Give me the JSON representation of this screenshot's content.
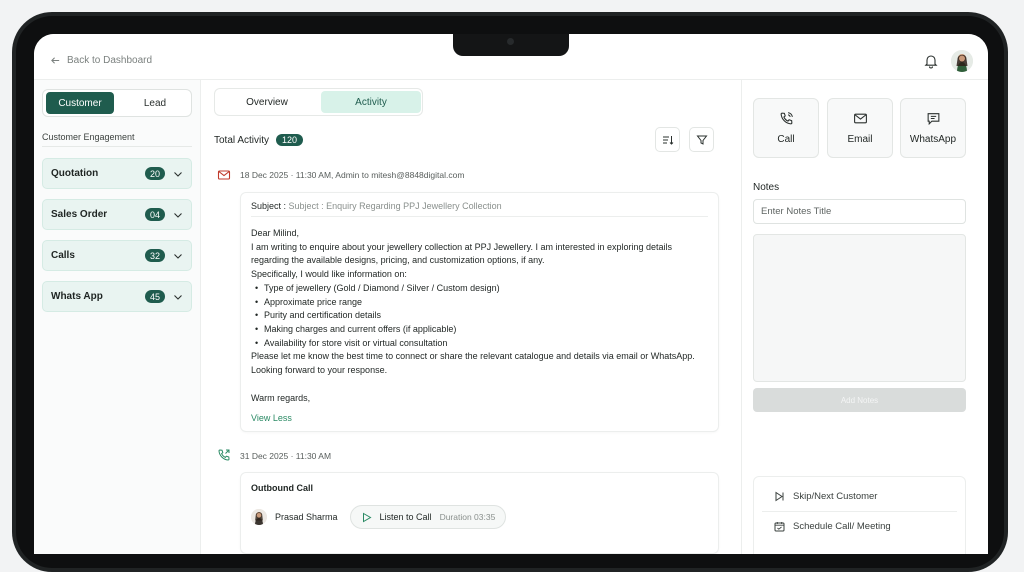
{
  "topbar": {
    "back_label": "Back to Dashboard",
    "icons": [
      "arrow-left-icon",
      "bell-icon",
      "user-avatar"
    ]
  },
  "sidebar": {
    "toggle": {
      "active": "Customer",
      "inactive": "Lead"
    },
    "section_label": "Customer Engagement",
    "items": [
      {
        "label": "Quotation",
        "count": "20"
      },
      {
        "label": "Sales Order",
        "count": "04"
      },
      {
        "label": "Calls",
        "count": "32"
      },
      {
        "label": "Whats App",
        "count": "45"
      }
    ]
  },
  "main": {
    "tabs": {
      "overview": "Overview",
      "activity": "Activity"
    },
    "total_label": "Total Activity",
    "total_count": "120",
    "email_entry": {
      "meta": "18 Dec 2025 · 11:30 AM, Admin to mitesh@8848digital.com",
      "subject_label": "Subject :",
      "subject_value": "Subject : Enquiry Regarding PPJ Jewellery Collection",
      "greeting": "Dear Milind,",
      "line1": "I am writing to enquire about your jewellery collection at PPJ Jewellery. I am interested in exploring details",
      "line2": "regarding the available designs, pricing, and customization options, if any.",
      "line3": "Specifically, I would like information on:",
      "bullets": [
        "Type of jewellery (Gold / Diamond / Silver / Custom design)",
        "Approximate price range",
        "Purity and certification details",
        "Making charges and current offers (if applicable)",
        "Availability for store visit or virtual consultation"
      ],
      "line4": "Please let me know the best time to connect or share the relevant catalogue and details via email or WhatsApp.",
      "line5": "Looking forward to your response.",
      "closing": "Warm regards,",
      "view_less": "View Less"
    },
    "call_entry": {
      "meta": "31 Dec 2025 · 11:30 AM",
      "title": "Outbound Call",
      "person": "Prasad Sharma",
      "listen_label": "Listen to Call",
      "duration": "Duration 03:35"
    }
  },
  "right_panel": {
    "quick_actions": {
      "call": "Call",
      "email": "Email",
      "whatsapp": "WhatsApp"
    },
    "notes_label": "Notes",
    "notes_placeholder": "Enter Notes Title",
    "add_notes": "Add Notes",
    "actions": {
      "skip": "Skip/Next Customer",
      "schedule": "Schedule Call/ Meeting"
    }
  },
  "colors": {
    "brand": "#1f5c4e",
    "brand_light": "#e9f4f1",
    "tab_active": "#d8f2e9",
    "link": "#2a8a64"
  }
}
